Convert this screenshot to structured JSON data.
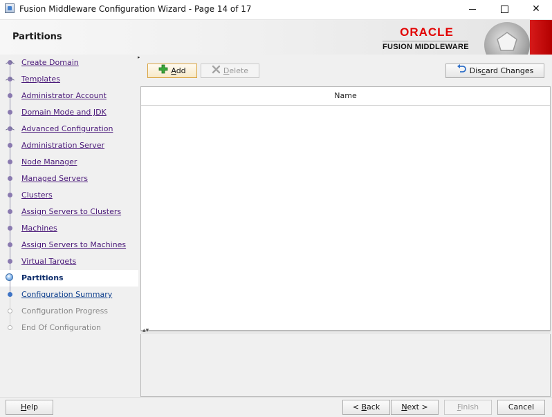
{
  "window": {
    "title": "Fusion Middleware Configuration Wizard - Page 14 of 17",
    "minimize_glyph": "",
    "maximize_glyph": "",
    "close_glyph": "✕"
  },
  "header": {
    "page_title": "Partitions",
    "brand_name": "ORACLE",
    "brand_subtitle": "FUSION MIDDLEWARE",
    "brand_color": "#e20000"
  },
  "nav": {
    "items": [
      {
        "label": "Create Domain",
        "state": "visited",
        "node": "branch"
      },
      {
        "label": "Templates",
        "state": "visited",
        "node": "branch"
      },
      {
        "label": "Administrator Account",
        "state": "visited",
        "node": "dot"
      },
      {
        "label": "Domain Mode and JDK",
        "state": "visited",
        "node": "dot"
      },
      {
        "label": "Advanced Configuration",
        "state": "visited",
        "node": "branch"
      },
      {
        "label": "Administration Server",
        "state": "visited",
        "node": "dot"
      },
      {
        "label": "Node Manager",
        "state": "visited",
        "node": "dot"
      },
      {
        "label": "Managed Servers",
        "state": "visited",
        "node": "dot"
      },
      {
        "label": "Clusters",
        "state": "visited",
        "node": "dot"
      },
      {
        "label": "Assign Servers to Clusters",
        "state": "visited",
        "node": "dot"
      },
      {
        "label": "Machines",
        "state": "visited",
        "node": "dot"
      },
      {
        "label": "Assign Servers to Machines",
        "state": "visited",
        "node": "dot"
      },
      {
        "label": "Virtual Targets",
        "state": "visited",
        "node": "dot"
      },
      {
        "label": "Partitions",
        "state": "current",
        "node": "dot"
      },
      {
        "label": "Configuration Summary",
        "state": "next",
        "node": "dot"
      },
      {
        "label": "Configuration Progress",
        "state": "future",
        "node": "dot"
      },
      {
        "label": "End Of Configuration",
        "state": "future",
        "node": "dot"
      }
    ]
  },
  "toolbar": {
    "add_label_mnemonic": "A",
    "add_label_rest": "dd",
    "delete_label_mnemonic": "D",
    "delete_label_rest": "elete",
    "discard_label_pre": "Dis",
    "discard_label_mnemonic": "c",
    "discard_label_rest": "ard Changes",
    "add_icon": "plus-icon",
    "delete_icon": "x-icon",
    "discard_icon": "undo-icon"
  },
  "table": {
    "columns": [
      "Name"
    ],
    "rows": []
  },
  "footer": {
    "help_mnemonic": "H",
    "help_rest": "elp",
    "back_pre": "< ",
    "back_mnemonic": "B",
    "back_rest": "ack",
    "next_mnemonic": "N",
    "next_rest": "ext >",
    "finish_mnemonic": "F",
    "finish_rest": "inish",
    "cancel_label": "Cancel"
  }
}
